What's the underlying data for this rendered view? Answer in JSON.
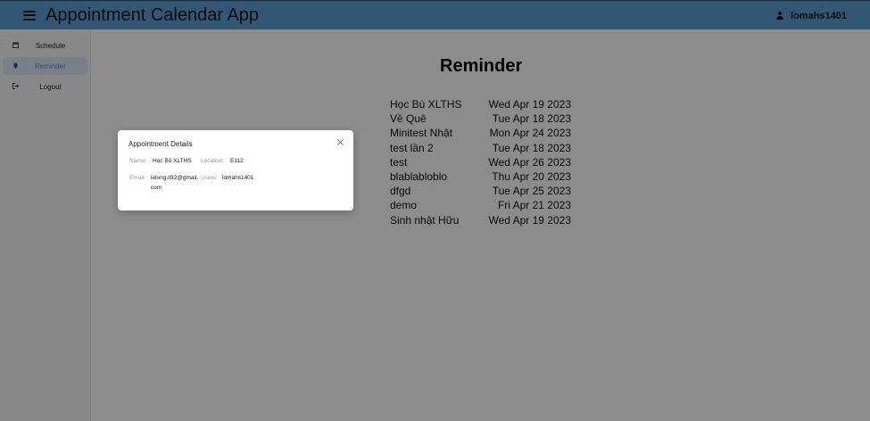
{
  "header": {
    "title": "Appointment Calendar App",
    "user_name": "lomahs1401"
  },
  "sidebar": {
    "items": [
      {
        "label": "Schedule",
        "icon": "calendar-icon",
        "active": false
      },
      {
        "label": "Reminder",
        "icon": "bell-icon",
        "active": true
      },
      {
        "label": "Logout",
        "icon": "logout-icon",
        "active": false
      }
    ]
  },
  "main": {
    "title": "Reminder",
    "reminders": [
      {
        "name": "Học Bù XLTHS",
        "date": "Wed Apr 19 2023"
      },
      {
        "name": "Về Quê",
        "date": "Tue Apr 18 2023"
      },
      {
        "name": "Minitest Nhật",
        "date": "Mon Apr 24 2023"
      },
      {
        "name": "test lần 2",
        "date": "Tue Apr 18 2023"
      },
      {
        "name": "test",
        "date": "Wed Apr 26 2023"
      },
      {
        "name": "blablabloblo",
        "date": "Thu Apr 20 2023"
      },
      {
        "name": "dfgd",
        "date": "Tue Apr 25 2023"
      },
      {
        "name": "demo",
        "date": "Fri Apr 21 2023"
      },
      {
        "name": "Sinh nhật Hữu",
        "date": "Wed Apr 19 2023"
      }
    ]
  },
  "modal": {
    "title": "Appointment Details",
    "name_label": "Name:",
    "name_value": "Học Bù XLTHS",
    "location_label": "Location:",
    "location_value": "E112",
    "email_label": "Email:",
    "email_value": "lelong.ll32@gmail.com",
    "users_label": "Users:",
    "users_value": "lomahs1401"
  },
  "colors": {
    "header": "#5a9fd4",
    "active_item": "#4c86d6",
    "overlay": "rgba(0,0,0,0.45)"
  }
}
